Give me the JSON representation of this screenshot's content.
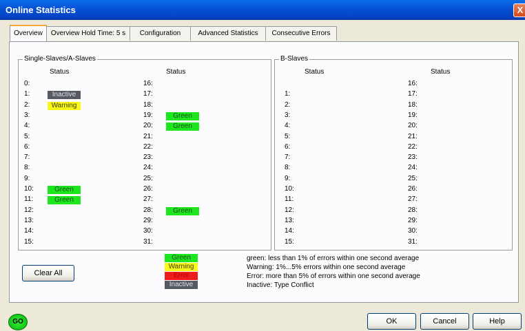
{
  "window": {
    "title": "Online Statistics",
    "close_label": "X"
  },
  "tabs": [
    {
      "label": "Overview"
    },
    {
      "label": "Overview  Hold Time: 5 s"
    },
    {
      "label": "Configuration"
    },
    {
      "label": "Advanced Statistics"
    },
    {
      "label": "Consecutive Errors"
    }
  ],
  "single_slaves": {
    "title": "Single-Slaves/A-Slaves",
    "status_header": "Status",
    "left": [
      {
        "n": "0:",
        "s": ""
      },
      {
        "n": "1:",
        "s": "Inactive"
      },
      {
        "n": "2:",
        "s": "Warning"
      },
      {
        "n": "3:",
        "s": ""
      },
      {
        "n": "4:",
        "s": ""
      },
      {
        "n": "5:",
        "s": ""
      },
      {
        "n": "6:",
        "s": ""
      },
      {
        "n": "7:",
        "s": ""
      },
      {
        "n": "8:",
        "s": ""
      },
      {
        "n": "9:",
        "s": ""
      },
      {
        "n": "10:",
        "s": "Green"
      },
      {
        "n": "11:",
        "s": "Green"
      },
      {
        "n": "12:",
        "s": ""
      },
      {
        "n": "13:",
        "s": ""
      },
      {
        "n": "14:",
        "s": ""
      },
      {
        "n": "15:",
        "s": ""
      }
    ],
    "right": [
      {
        "n": "16:",
        "s": ""
      },
      {
        "n": "17:",
        "s": ""
      },
      {
        "n": "18:",
        "s": ""
      },
      {
        "n": "19:",
        "s": "Green"
      },
      {
        "n": "20:",
        "s": "Green"
      },
      {
        "n": "21:",
        "s": ""
      },
      {
        "n": "22:",
        "s": ""
      },
      {
        "n": "23:",
        "s": ""
      },
      {
        "n": "24:",
        "s": ""
      },
      {
        "n": "25:",
        "s": ""
      },
      {
        "n": "26:",
        "s": ""
      },
      {
        "n": "27:",
        "s": ""
      },
      {
        "n": "28:",
        "s": "Green"
      },
      {
        "n": "29:",
        "s": ""
      },
      {
        "n": "30:",
        "s": ""
      },
      {
        "n": "31:",
        "s": ""
      }
    ]
  },
  "b_slaves": {
    "title": "B-Slaves",
    "status_header": "Status",
    "left": [
      {
        "n": "",
        "s": ""
      },
      {
        "n": "1:",
        "s": ""
      },
      {
        "n": "2:",
        "s": ""
      },
      {
        "n": "3:",
        "s": ""
      },
      {
        "n": "4:",
        "s": ""
      },
      {
        "n": "5:",
        "s": ""
      },
      {
        "n": "6:",
        "s": ""
      },
      {
        "n": "7:",
        "s": ""
      },
      {
        "n": "8:",
        "s": ""
      },
      {
        "n": "9:",
        "s": ""
      },
      {
        "n": "10:",
        "s": ""
      },
      {
        "n": "11:",
        "s": ""
      },
      {
        "n": "12:",
        "s": ""
      },
      {
        "n": "13:",
        "s": ""
      },
      {
        "n": "14:",
        "s": ""
      },
      {
        "n": "15:",
        "s": ""
      }
    ],
    "right": [
      {
        "n": "16:",
        "s": ""
      },
      {
        "n": "17:",
        "s": ""
      },
      {
        "n": "18:",
        "s": ""
      },
      {
        "n": "19:",
        "s": ""
      },
      {
        "n": "20:",
        "s": ""
      },
      {
        "n": "21:",
        "s": ""
      },
      {
        "n": "22:",
        "s": ""
      },
      {
        "n": "23:",
        "s": ""
      },
      {
        "n": "24:",
        "s": ""
      },
      {
        "n": "25:",
        "s": ""
      },
      {
        "n": "26:",
        "s": ""
      },
      {
        "n": "27:",
        "s": ""
      },
      {
        "n": "28:",
        "s": ""
      },
      {
        "n": "29:",
        "s": ""
      },
      {
        "n": "30:",
        "s": ""
      },
      {
        "n": "31:",
        "s": ""
      }
    ]
  },
  "legend": [
    {
      "chip": "Green",
      "type": "green",
      "text": "green: less than 1% of errors within one second average"
    },
    {
      "chip": "Warning",
      "type": "warning",
      "text": "Warning: 1%...5% errors within one second average"
    },
    {
      "chip": "Error",
      "type": "error",
      "text": "Error: more than 5% of errors within one second average"
    },
    {
      "chip": "Inactive",
      "type": "inactive",
      "text": "Inactive: Type Conflict"
    }
  ],
  "buttons": {
    "clear_all": "Clear All",
    "ok": "OK",
    "cancel": "Cancel",
    "help": "Help"
  },
  "indicator": {
    "label": "GO",
    "color": "#1ee61e"
  },
  "colors": {
    "green": "#1ee61e",
    "warning": "#f8f818",
    "error": "#ee1c1c",
    "inactive": "#555a62",
    "title_bar": "#0753d6"
  }
}
